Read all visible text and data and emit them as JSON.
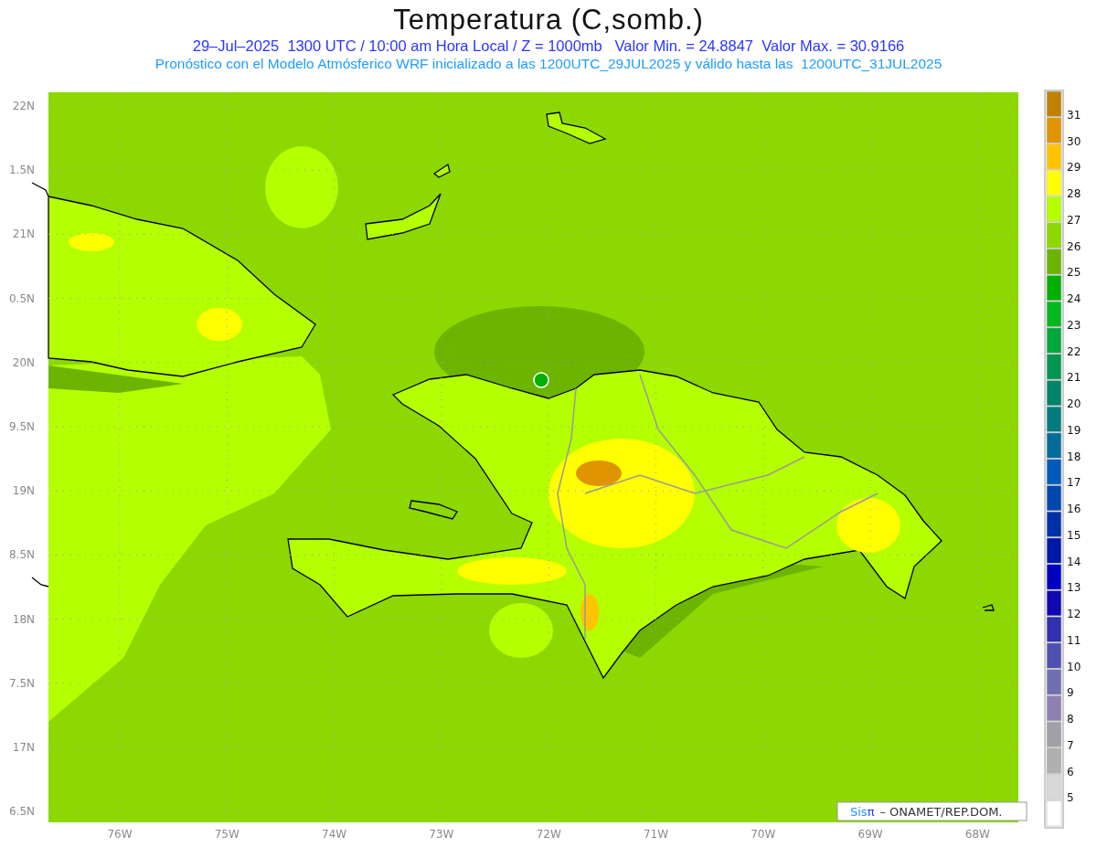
{
  "title": "Temperatura (C,somb.)",
  "subtitle": "29–Jul–2025  1300 UTC / 10:00 am Hora Local / Z = 1000mb   Valor Min. = 24.8847  Valor Max. = 30.9166",
  "info_line": "Pronóstico con el Modelo Atmósferico WRF inicializado a las 1200UTC_29JUL2025 y válido hasta las  1200UTC_31JUL2025",
  "map": {
    "y_axis_labels": [
      "22N",
      "1.5N",
      "21N",
      "0.5N",
      "20N",
      "9.5N",
      "19N",
      "8.5N",
      "18N",
      "7.5N",
      "17N",
      "6.5N"
    ],
    "x_axis_labels": [
      "76W",
      "75W",
      "74W",
      "73W",
      "72W",
      "71W",
      "70W",
      "69W",
      "68W"
    ],
    "credit": {
      "brand": "Sis",
      "symbol": "π",
      "text": "– ONAMET/REP.DOM."
    }
  },
  "legend": {
    "boxes": [
      {
        "color": "#c08000"
      },
      {
        "color": "#e09400"
      },
      {
        "color": "#ffc400"
      },
      {
        "color": "#ffff00"
      },
      {
        "color": "#b4ff00"
      },
      {
        "color": "#8cd800"
      },
      {
        "color": "#6cb400"
      },
      {
        "color": "#00b000"
      },
      {
        "color": "#00b820"
      },
      {
        "color": "#00a83c"
      },
      {
        "color": "#009650"
      },
      {
        "color": "#008468"
      },
      {
        "color": "#007c7c"
      },
      {
        "color": "#006c9c"
      },
      {
        "color": "#005cb8"
      },
      {
        "color": "#0048b0"
      },
      {
        "color": "#0030a8"
      },
      {
        "color": "#0018a8"
      },
      {
        "color": "#0000c0"
      },
      {
        "color": "#1008b0"
      },
      {
        "color": "#3030b0"
      },
      {
        "color": "#5050b0"
      },
      {
        "color": "#7070b0"
      },
      {
        "color": "#9080b0"
      },
      {
        "color": "#a0a0a8"
      },
      {
        "color": "#b0b0b0"
      },
      {
        "color": "#d8d8d8"
      },
      {
        "color": "#ffffff"
      }
    ],
    "labels": [
      "31",
      "30",
      "29",
      "28",
      "27",
      "26",
      "25",
      "24",
      "23",
      "22",
      "21",
      "20",
      "19",
      "18",
      "17",
      "16",
      "15",
      "14",
      "13",
      "12",
      "11",
      "10",
      "9",
      "8",
      "7",
      "6",
      "5"
    ]
  }
}
